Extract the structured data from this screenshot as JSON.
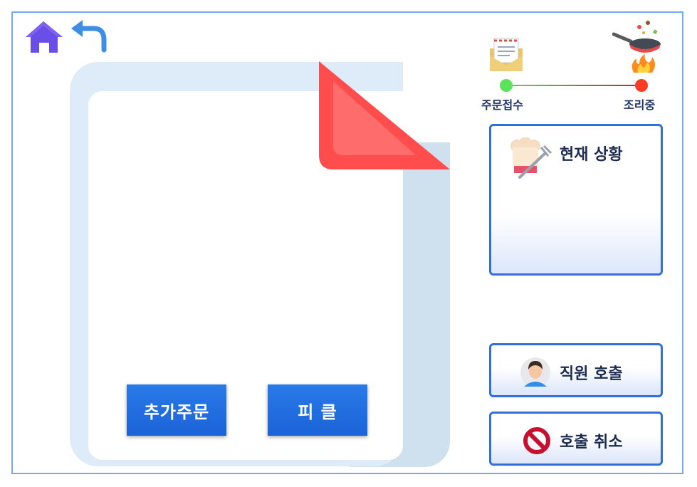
{
  "nav": {
    "home_icon": "home-icon",
    "back_icon": "back-arrow-icon"
  },
  "order": {
    "add_order_label": "추가주문",
    "pickle_label": "피 클"
  },
  "progress": {
    "steps": [
      {
        "label": "주문접수",
        "icon": "order-envelope-icon",
        "color": "#5ce25c"
      },
      {
        "label": "조리중",
        "icon": "cooking-pan-icon",
        "color": "#ff3b22"
      }
    ]
  },
  "status_panel": {
    "title": "현재 상황",
    "icon": "chef-hat-fork-icon"
  },
  "buttons": {
    "call_staff": {
      "label": "직원 호출",
      "icon": "staff-avatar-icon"
    },
    "cancel_call": {
      "label": "호출 취소",
      "icon": "no-sign-icon"
    }
  },
  "colors": {
    "accent": "#1a63d8",
    "border": "#3070d8",
    "fold": "#ff4c4c"
  }
}
